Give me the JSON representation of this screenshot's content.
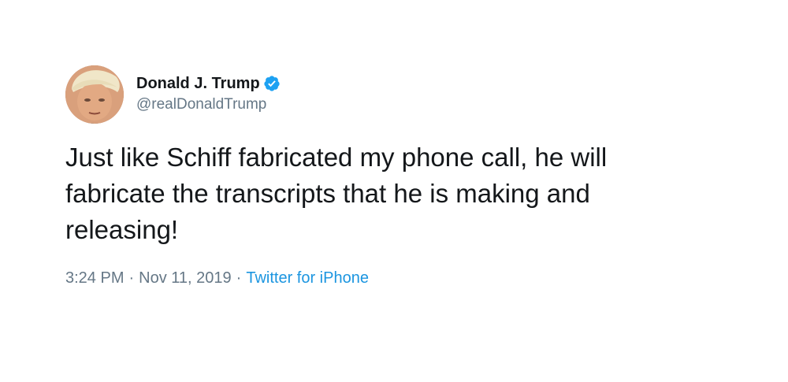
{
  "tweet": {
    "author": {
      "display_name": "Donald J. Trump",
      "handle": "@realDonaldTrump",
      "verified_icon": "verified-badge-icon"
    },
    "text": "Just like Schiff fabricated my phone call, he will fabricate the transcripts that he is making and releasing!",
    "time": "3:24 PM",
    "date": "Nov 11, 2019",
    "separator": "·",
    "source": "Twitter for iPhone"
  },
  "colors": {
    "text": "#14171a",
    "secondary": "#657786",
    "link": "#1b95e0",
    "verified": "#1da1f2"
  }
}
